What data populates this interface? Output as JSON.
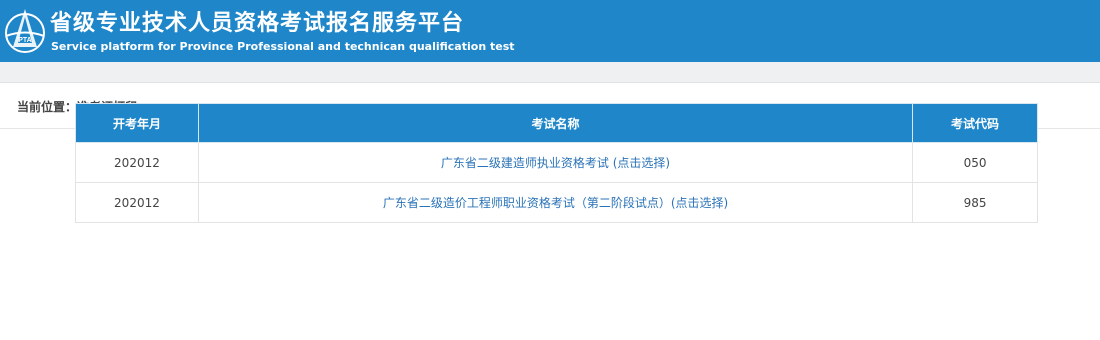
{
  "header": {
    "title_cn": "省级专业技术人员资格考试报名服务平台",
    "title_en": "Service platform for Province Professional and technican qualification test",
    "logo_text": "PTA"
  },
  "breadcrumb": {
    "text": "当前位置：准考证打印"
  },
  "table": {
    "headers": [
      "开考年月",
      "考试名称",
      "考试代码"
    ],
    "rows": [
      {
        "month": "202012",
        "name": "广东省二级建造师执业资格考试 (点击选择)",
        "code": "050"
      },
      {
        "month": "202012",
        "name": "广东省二级造价工程师职业资格考试（第二阶段试点）(点击选择)",
        "code": "985"
      }
    ]
  },
  "colors": {
    "brand": "#1e86c9",
    "link": "#2a73b8"
  }
}
